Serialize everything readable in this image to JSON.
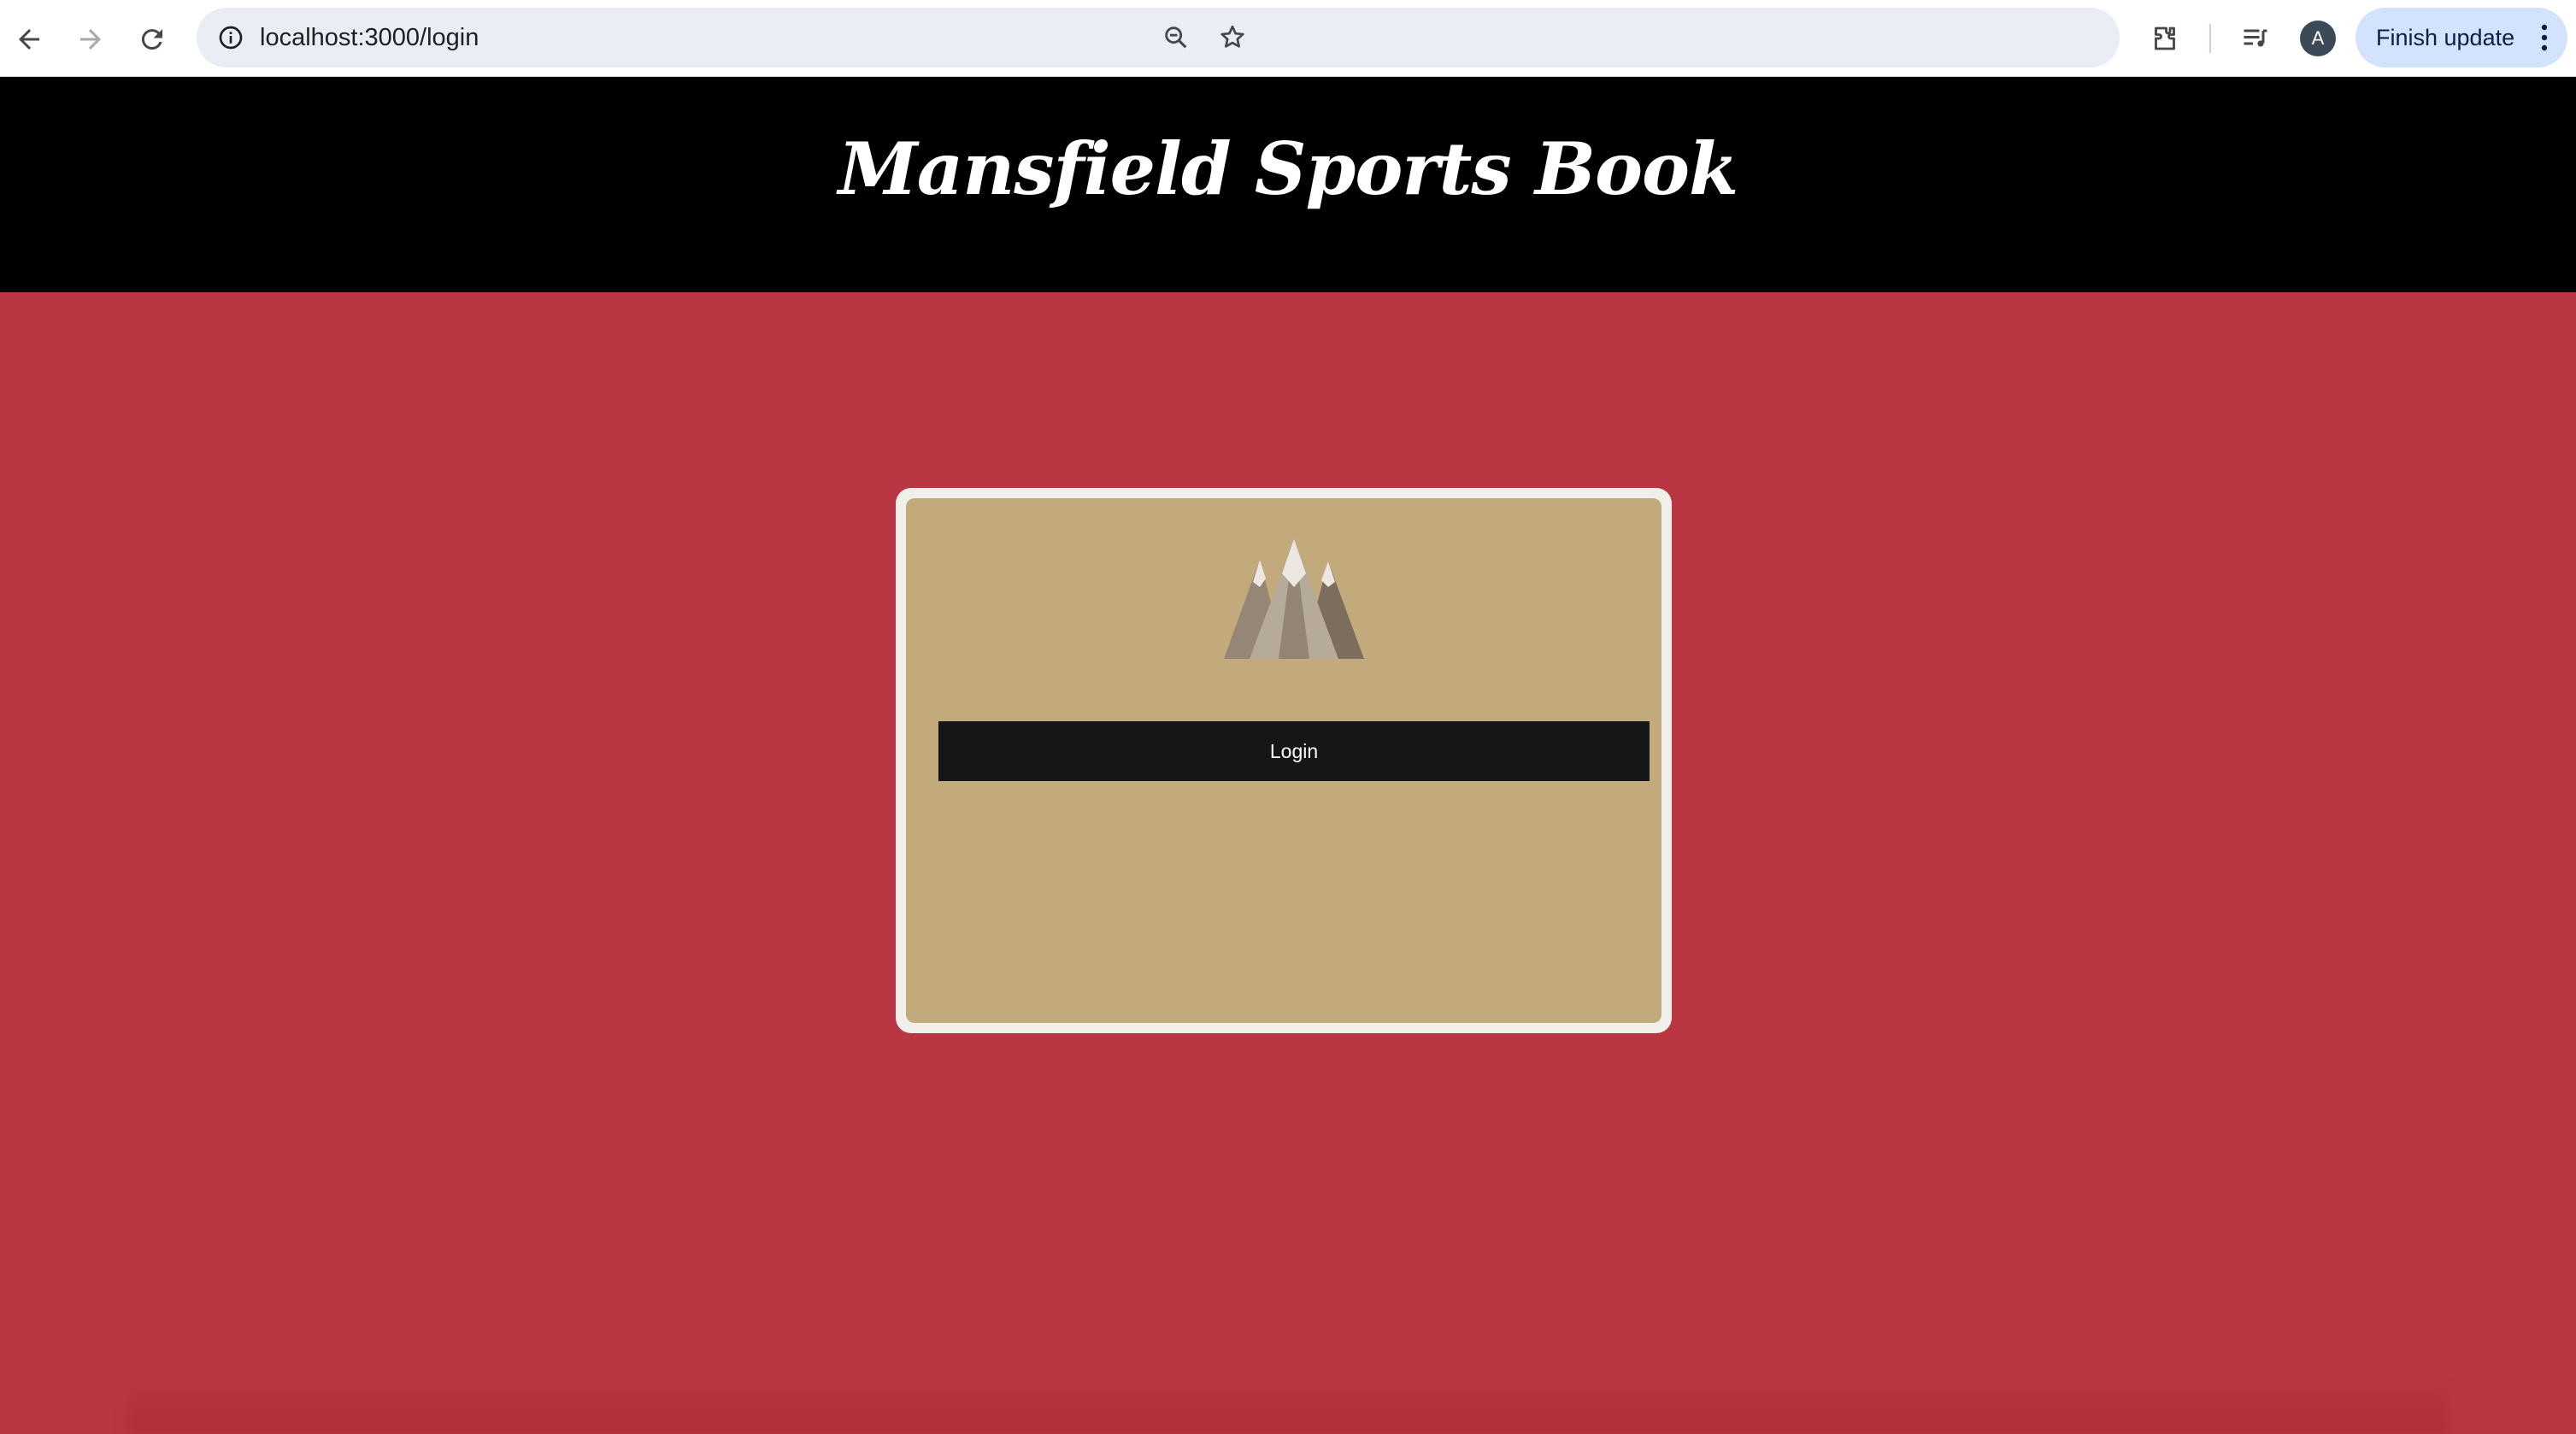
{
  "browser": {
    "url": "localhost:3000/login",
    "profile_initial": "A",
    "update_button_label": "Finish update",
    "icons": [
      "back-arrow-icon",
      "forward-arrow-icon",
      "reload-icon",
      "site-info-icon",
      "zoom-icon",
      "bookmark-star-icon",
      "extensions-icon",
      "media-controls-icon",
      "more-menu-icon"
    ]
  },
  "header": {
    "title": "Mansfield Sports Book"
  },
  "login_card": {
    "logo_icon": "mountain-logo-icon",
    "login_button_label": "Login"
  },
  "colors": {
    "page_background": "#b93643",
    "header_background": "#000000",
    "card_background": "#c3aa7d",
    "card_border": "#f1efe9",
    "button_background": "#161616"
  }
}
